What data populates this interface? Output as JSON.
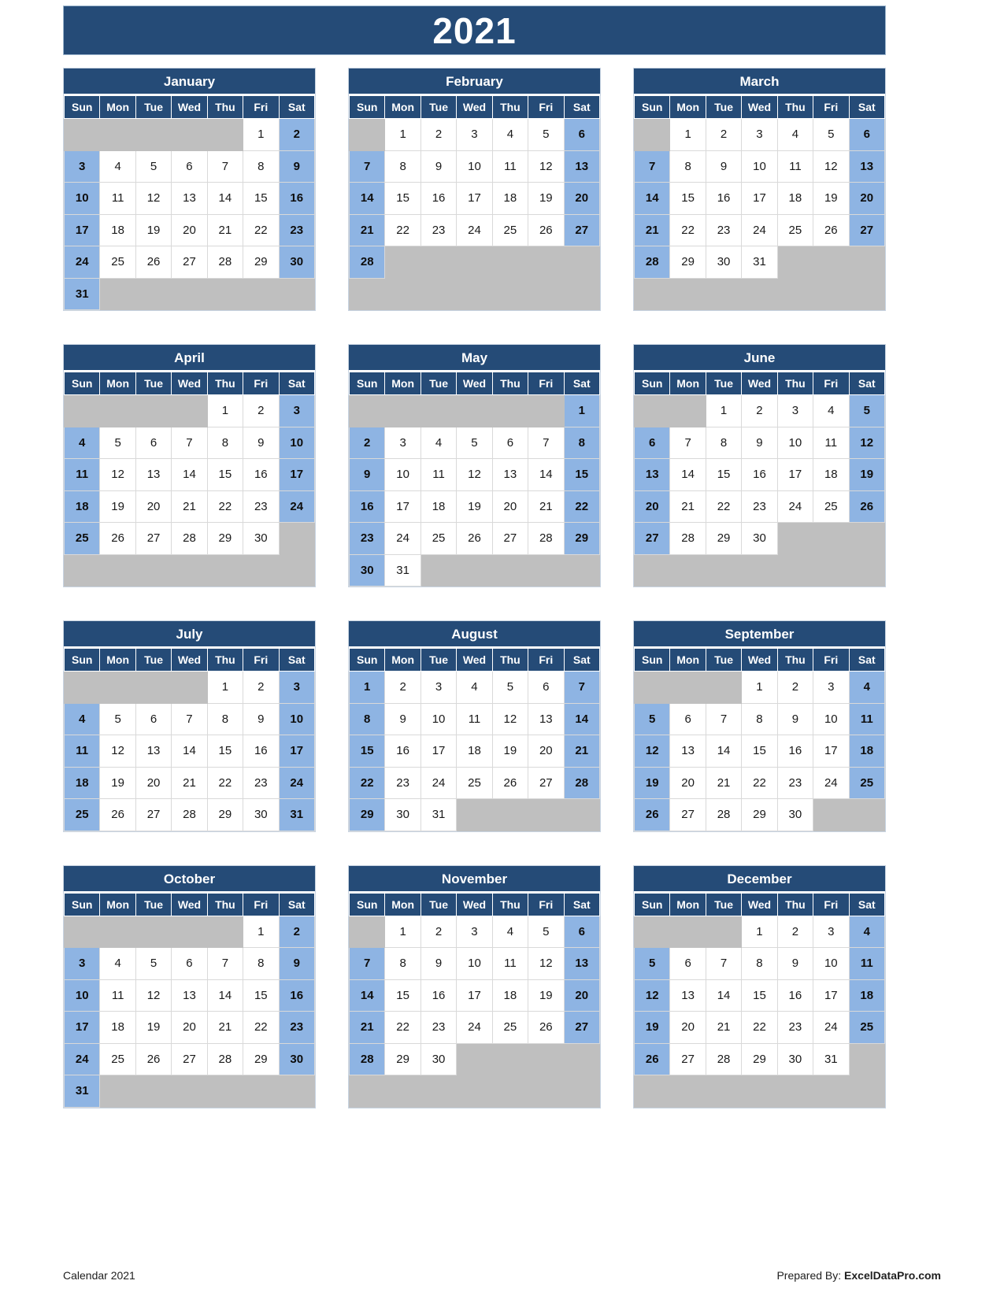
{
  "title": {
    "year": "2021"
  },
  "weekday_headers": [
    "Sun",
    "Mon",
    "Tue",
    "Wed",
    "Thu",
    "Fri",
    "Sat"
  ],
  "colors": {
    "header_blue": "#254B77",
    "weekend_blue": "#8EB4E3",
    "empty_gray": "#BFBFBF",
    "day_white": "#FFFFFF",
    "grid_line": "#D9D9D9",
    "text_dark": "#1A1A1A",
    "text_light": "#FFFFFF"
  },
  "footer": {
    "left": "Calendar 2021",
    "right_prefix": "Prepared By: ",
    "right_brand": "ExcelDataPro.com"
  },
  "months": [
    {
      "name": "January",
      "lead_blank": 5,
      "days": 31,
      "weeks": [
        [
          "",
          "",
          "",
          "",
          "",
          "1",
          "2"
        ],
        [
          "3",
          "4",
          "5",
          "6",
          "7",
          "8",
          "9"
        ],
        [
          "10",
          "11",
          "12",
          "13",
          "14",
          "15",
          "16"
        ],
        [
          "17",
          "18",
          "19",
          "20",
          "21",
          "22",
          "23"
        ],
        [
          "24",
          "25",
          "26",
          "27",
          "28",
          "29",
          "30"
        ],
        [
          "31",
          "",
          "",
          "",
          "",
          "",
          ""
        ]
      ]
    },
    {
      "name": "February",
      "lead_blank": 1,
      "days": 28,
      "weeks": [
        [
          "",
          "1",
          "2",
          "3",
          "4",
          "5",
          "6"
        ],
        [
          "7",
          "8",
          "9",
          "10",
          "11",
          "12",
          "13"
        ],
        [
          "14",
          "15",
          "16",
          "17",
          "18",
          "19",
          "20"
        ],
        [
          "21",
          "22",
          "23",
          "24",
          "25",
          "26",
          "27"
        ],
        [
          "28",
          "",
          "",
          "",
          "",
          "",
          ""
        ],
        [
          "",
          "",
          "",
          "",
          "",
          "",
          ""
        ]
      ]
    },
    {
      "name": "March",
      "lead_blank": 1,
      "days": 31,
      "weeks": [
        [
          "",
          "1",
          "2",
          "3",
          "4",
          "5",
          "6"
        ],
        [
          "7",
          "8",
          "9",
          "10",
          "11",
          "12",
          "13"
        ],
        [
          "14",
          "15",
          "16",
          "17",
          "18",
          "19",
          "20"
        ],
        [
          "21",
          "22",
          "23",
          "24",
          "25",
          "26",
          "27"
        ],
        [
          "28",
          "29",
          "30",
          "31",
          "",
          "",
          ""
        ],
        [
          "",
          "",
          "",
          "",
          "",
          "",
          ""
        ]
      ]
    },
    {
      "name": "April",
      "lead_blank": 4,
      "days": 30,
      "weeks": [
        [
          "",
          "",
          "",
          "",
          "1",
          "2",
          "3"
        ],
        [
          "4",
          "5",
          "6",
          "7",
          "8",
          "9",
          "10"
        ],
        [
          "11",
          "12",
          "13",
          "14",
          "15",
          "16",
          "17"
        ],
        [
          "18",
          "19",
          "20",
          "21",
          "22",
          "23",
          "24"
        ],
        [
          "25",
          "26",
          "27",
          "28",
          "29",
          "30",
          ""
        ],
        [
          "",
          "",
          "",
          "",
          "",
          "",
          ""
        ]
      ]
    },
    {
      "name": "May",
      "lead_blank": 6,
      "days": 31,
      "weeks": [
        [
          "",
          "",
          "",
          "",
          "",
          "",
          "1"
        ],
        [
          "2",
          "3",
          "4",
          "5",
          "6",
          "7",
          "8"
        ],
        [
          "9",
          "10",
          "11",
          "12",
          "13",
          "14",
          "15"
        ],
        [
          "16",
          "17",
          "18",
          "19",
          "20",
          "21",
          "22"
        ],
        [
          "23",
          "24",
          "25",
          "26",
          "27",
          "28",
          "29"
        ],
        [
          "30",
          "31",
          "",
          "",
          "",
          "",
          ""
        ]
      ]
    },
    {
      "name": "June",
      "lead_blank": 2,
      "days": 30,
      "weeks": [
        [
          "",
          "",
          "1",
          "2",
          "3",
          "4",
          "5"
        ],
        [
          "6",
          "7",
          "8",
          "9",
          "10",
          "11",
          "12"
        ],
        [
          "13",
          "14",
          "15",
          "16",
          "17",
          "18",
          "19"
        ],
        [
          "20",
          "21",
          "22",
          "23",
          "24",
          "25",
          "26"
        ],
        [
          "27",
          "28",
          "29",
          "30",
          "",
          "",
          ""
        ],
        [
          "",
          "",
          "",
          "",
          "",
          "",
          ""
        ]
      ]
    },
    {
      "name": "July",
      "lead_blank": 4,
      "days": 31,
      "weeks": [
        [
          "",
          "",
          "",
          "",
          "1",
          "2",
          "3"
        ],
        [
          "4",
          "5",
          "6",
          "7",
          "8",
          "9",
          "10"
        ],
        [
          "11",
          "12",
          "13",
          "14",
          "15",
          "16",
          "17"
        ],
        [
          "18",
          "19",
          "20",
          "21",
          "22",
          "23",
          "24"
        ],
        [
          "25",
          "26",
          "27",
          "28",
          "29",
          "30",
          "31"
        ]
      ]
    },
    {
      "name": "August",
      "lead_blank": 0,
      "days": 31,
      "weeks": [
        [
          "1",
          "2",
          "3",
          "4",
          "5",
          "6",
          "7"
        ],
        [
          "8",
          "9",
          "10",
          "11",
          "12",
          "13",
          "14"
        ],
        [
          "15",
          "16",
          "17",
          "18",
          "19",
          "20",
          "21"
        ],
        [
          "22",
          "23",
          "24",
          "25",
          "26",
          "27",
          "28"
        ],
        [
          "29",
          "30",
          "31",
          "",
          "",
          "",
          ""
        ]
      ]
    },
    {
      "name": "September",
      "lead_blank": 3,
      "days": 30,
      "weeks": [
        [
          "",
          "",
          "",
          "1",
          "2",
          "3",
          "4"
        ],
        [
          "5",
          "6",
          "7",
          "8",
          "9",
          "10",
          "11"
        ],
        [
          "12",
          "13",
          "14",
          "15",
          "16",
          "17",
          "18"
        ],
        [
          "19",
          "20",
          "21",
          "22",
          "23",
          "24",
          "25"
        ],
        [
          "26",
          "27",
          "28",
          "29",
          "30",
          "",
          ""
        ]
      ]
    },
    {
      "name": "October",
      "lead_blank": 5,
      "days": 31,
      "weeks": [
        [
          "",
          "",
          "",
          "",
          "",
          "1",
          "2"
        ],
        [
          "3",
          "4",
          "5",
          "6",
          "7",
          "8",
          "9"
        ],
        [
          "10",
          "11",
          "12",
          "13",
          "14",
          "15",
          "16"
        ],
        [
          "17",
          "18",
          "19",
          "20",
          "21",
          "22",
          "23"
        ],
        [
          "24",
          "25",
          "26",
          "27",
          "28",
          "29",
          "30"
        ],
        [
          "31",
          "",
          "",
          "",
          "",
          "",
          ""
        ]
      ]
    },
    {
      "name": "November",
      "lead_blank": 1,
      "days": 30,
      "weeks": [
        [
          "",
          "1",
          "2",
          "3",
          "4",
          "5",
          "6"
        ],
        [
          "7",
          "8",
          "9",
          "10",
          "11",
          "12",
          "13"
        ],
        [
          "14",
          "15",
          "16",
          "17",
          "18",
          "19",
          "20"
        ],
        [
          "21",
          "22",
          "23",
          "24",
          "25",
          "26",
          "27"
        ],
        [
          "28",
          "29",
          "30",
          "",
          "",
          "",
          ""
        ],
        [
          "",
          "",
          "",
          "",
          "",
          "",
          ""
        ]
      ]
    },
    {
      "name": "December",
      "lead_blank": 3,
      "days": 31,
      "weeks": [
        [
          "",
          "",
          "",
          "1",
          "2",
          "3",
          "4"
        ],
        [
          "5",
          "6",
          "7",
          "8",
          "9",
          "10",
          "11"
        ],
        [
          "12",
          "13",
          "14",
          "15",
          "16",
          "17",
          "18"
        ],
        [
          "19",
          "20",
          "21",
          "22",
          "23",
          "24",
          "25"
        ],
        [
          "26",
          "27",
          "28",
          "29",
          "30",
          "31",
          ""
        ],
        [
          "",
          "",
          "",
          "",
          "",
          "",
          ""
        ]
      ]
    }
  ]
}
